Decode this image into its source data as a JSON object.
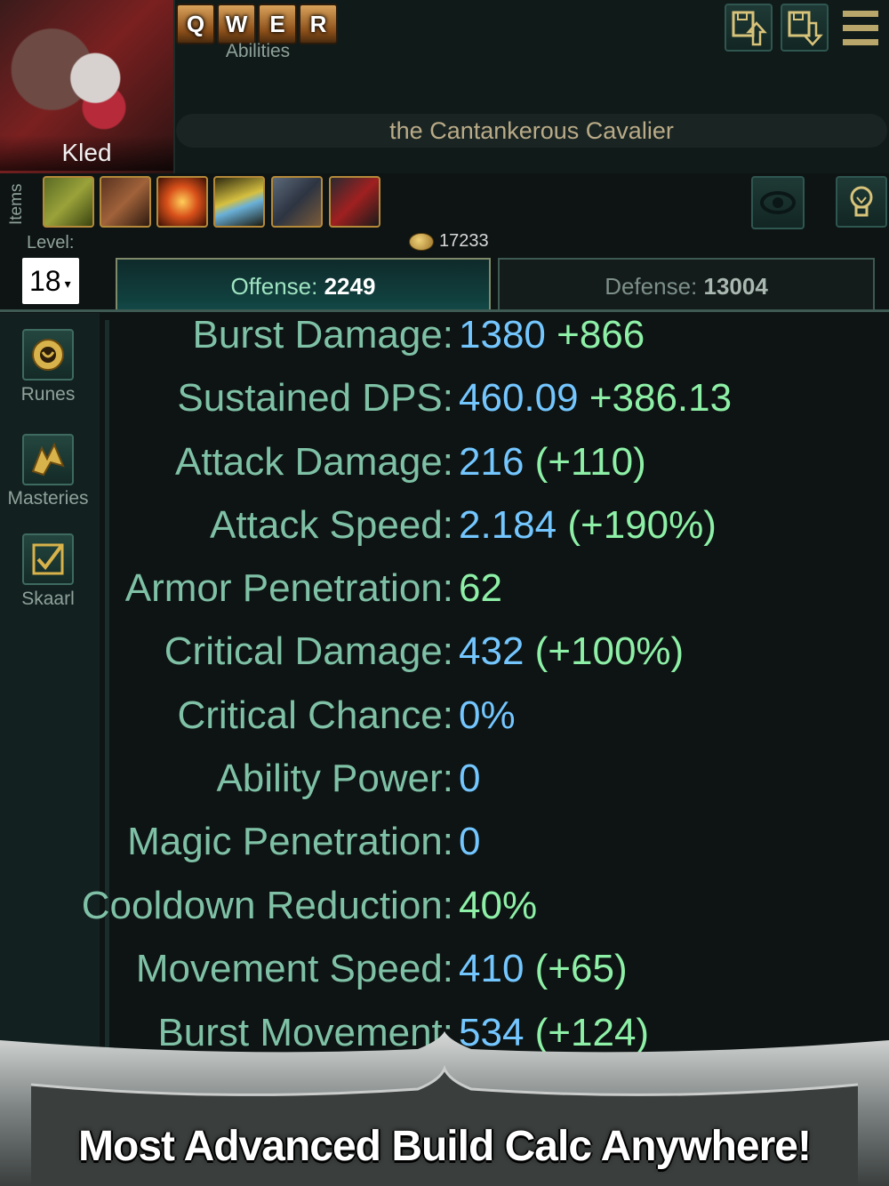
{
  "champion": {
    "name": "Kled",
    "title": "the Cantankerous Cavalier"
  },
  "abilities": {
    "keys": [
      "Q",
      "W",
      "E",
      "R"
    ],
    "label": "Abilities"
  },
  "items": {
    "label": "Items",
    "icons": [
      "boots-icon",
      "beast-item-icon",
      "flame-item-icon",
      "gold-gem-icon",
      "spear-item-icon",
      "dark-blade-icon"
    ]
  },
  "gold": "17233",
  "level": {
    "label": "Level:",
    "value": "18",
    "arrow": "▾"
  },
  "tabs": {
    "offense": {
      "label": "Offense:",
      "value": "2249"
    },
    "defense": {
      "label": "Defense:",
      "value": "13004"
    }
  },
  "sidebar": [
    {
      "label": "Runes",
      "icon": "runes-icon"
    },
    {
      "label": "Masteries",
      "icon": "masteries-icon"
    },
    {
      "label": "Skaarl",
      "icon": "checkbox-icon"
    }
  ],
  "stats": [
    {
      "label": "Burst Damage:",
      "value": "1380",
      "bonus": "+866"
    },
    {
      "label": "Sustained DPS:",
      "value": "460.09",
      "bonus": "+386.13"
    },
    {
      "label": "Attack Damage:",
      "value": "216",
      "bonus": "(+110)"
    },
    {
      "label": "Attack Speed:",
      "value": "2.184",
      "bonus": "(+190%)"
    },
    {
      "label": "Armor Penetration:",
      "value": "",
      "bonus": "62"
    },
    {
      "label": "Critical Damage:",
      "value": "432",
      "bonus": "(+100%)"
    },
    {
      "label": "Critical Chance:",
      "value": "0%",
      "bonus": ""
    },
    {
      "label": "Ability Power:",
      "value": "0",
      "bonus": ""
    },
    {
      "label": "Magic Penetration:",
      "value": "0",
      "bonus": ""
    },
    {
      "label": "Cooldown Reduction:",
      "value": "",
      "bonus": "40%"
    },
    {
      "label": "Movement Speed:",
      "value": "410",
      "bonus": "(+65)"
    },
    {
      "label": "Burst Movement:",
      "value": "534",
      "bonus": "(+124)"
    }
  ],
  "banner": "Most Advanced Build Calc Anywhere!",
  "colors": {
    "stat_label": "#7fc1a6",
    "value_blue": "#74c6ff",
    "value_green": "#8ef0a7",
    "gold_border": "#b48a3a"
  }
}
